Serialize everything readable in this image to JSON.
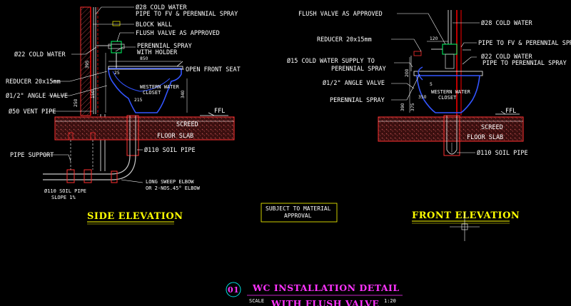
{
  "side_labels": {
    "cold_water_28": "Ø28 COLD WATER",
    "pipe_to_fv": "PIPE TO FV & PERENNIAL SPRAY",
    "block_wall": "BLOCK WALL",
    "flush_valve": "FLUSH VALVE AS APPROVED",
    "perennial_spray": "PERENNIAL SPRAY",
    "with_holder": "WITH HOLDER",
    "cold_water_22": "Ø22 COLD WATER",
    "open_front_seat": "OPEN FRONT SEAT",
    "reducer": "REDUCER 20x15mm",
    "angle_valve": "Ø1/2\" ANGLE VALVE",
    "vent_pipe": "Ø50 VENT PIPE",
    "screed": "SCREED",
    "floor_slab": "FLOOR SLAB",
    "ffl": "FFL",
    "soil_pipe": "Ø110 SOIL PIPE",
    "pipe_support": "PIPE SUPPORT",
    "soil_pipe_bottom": "Ø110 SOIL PIPE",
    "slope": "SLOPE 1%",
    "long_sweep_1": "LONG SWEEP ELBOW",
    "long_sweep_2": "OR 2-NOS.45° ELBOW",
    "closet_1": "WESTERN WATER",
    "closet_2": "CLOSET",
    "dim_850": "850",
    "dim_395": "395",
    "dim_340": "340",
    "dim_215": "215",
    "dim_150": "150",
    "dim_25": "25",
    "dim_250": "250",
    "title": "SIDE ELEVATION"
  },
  "front_labels": {
    "flush_valve": "FLUSH VALVE AS APPROVED",
    "cold_water_28": "Ø28 COLD WATER",
    "reducer": "REDUCER 20x15mm",
    "pipe_to_fv": "PIPE TO FV & PERENNIAL SPRAY",
    "cold_supply_1": "Ø15 COLD WATER SUPPLY TO",
    "cold_supply_2": "PERENNIAL SPRAY",
    "cold_water_22_1": "Ø22 COLD WATER",
    "cold_water_22_2": "PIPE TO PERENNIAL SPRAY",
    "angle_valve": "Ø1/2\" ANGLE VALVE",
    "perennial_spray": "PERENNIAL SPRAY",
    "ffl": "FFL",
    "screed": "SCREED",
    "floor_slab": "FLOOR SLAB",
    "soil_pipe": "Ø110 SOIL PIPE",
    "closet_1": "WESTERN WATER",
    "closet_2": "CLOSET",
    "dim_120": "120",
    "dim_200": "200",
    "dim_350": "350",
    "dim_390": "390",
    "dim_375": "375",
    "dim_5": "5",
    "title": "FRONT ELEVATION"
  },
  "note": {
    "line1": "SUBJECT TO MATERIAL",
    "line2": "APPROVAL"
  },
  "title_block": {
    "number": "01",
    "line1": "WC INSTALLATION DETAIL",
    "line2": "WITH FLUSH VALVE",
    "scale_label": "SCALE",
    "scale_value": "1:20"
  },
  "colors": {
    "background": "#000000",
    "wall_red": "#ff0000",
    "hatch_brown": "#8b2a2a",
    "text_white": "#ffffff",
    "title_yellow": "#ffff00",
    "title_magenta": "#ff33ff",
    "closet_blue": "#3355ff",
    "pipe_gray": "#c8c8c8",
    "valve_green": "#00ff66",
    "cyan": "#00e0e0"
  }
}
